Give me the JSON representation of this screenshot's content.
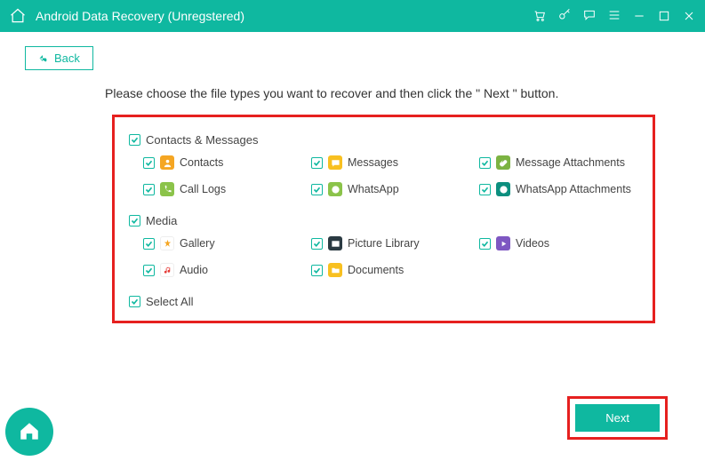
{
  "titlebar": {
    "title": "Android Data Recovery (Unregstered)"
  },
  "back_label": "Back",
  "instruction": "Please choose the file types you want to recover and then click the \" Next \" button.",
  "groups": {
    "contacts": {
      "header": "Contacts & Messages",
      "items": {
        "contacts": "Contacts",
        "messages": "Messages",
        "msg_att": "Message Attachments",
        "call_logs": "Call Logs",
        "whatsapp": "WhatsApp",
        "wa_att": "WhatsApp Attachments"
      }
    },
    "media": {
      "header": "Media",
      "items": {
        "gallery": "Gallery",
        "piclib": "Picture Library",
        "videos": "Videos",
        "audio": "Audio",
        "docs": "Documents"
      }
    }
  },
  "select_all": "Select All",
  "next_label": "Next"
}
